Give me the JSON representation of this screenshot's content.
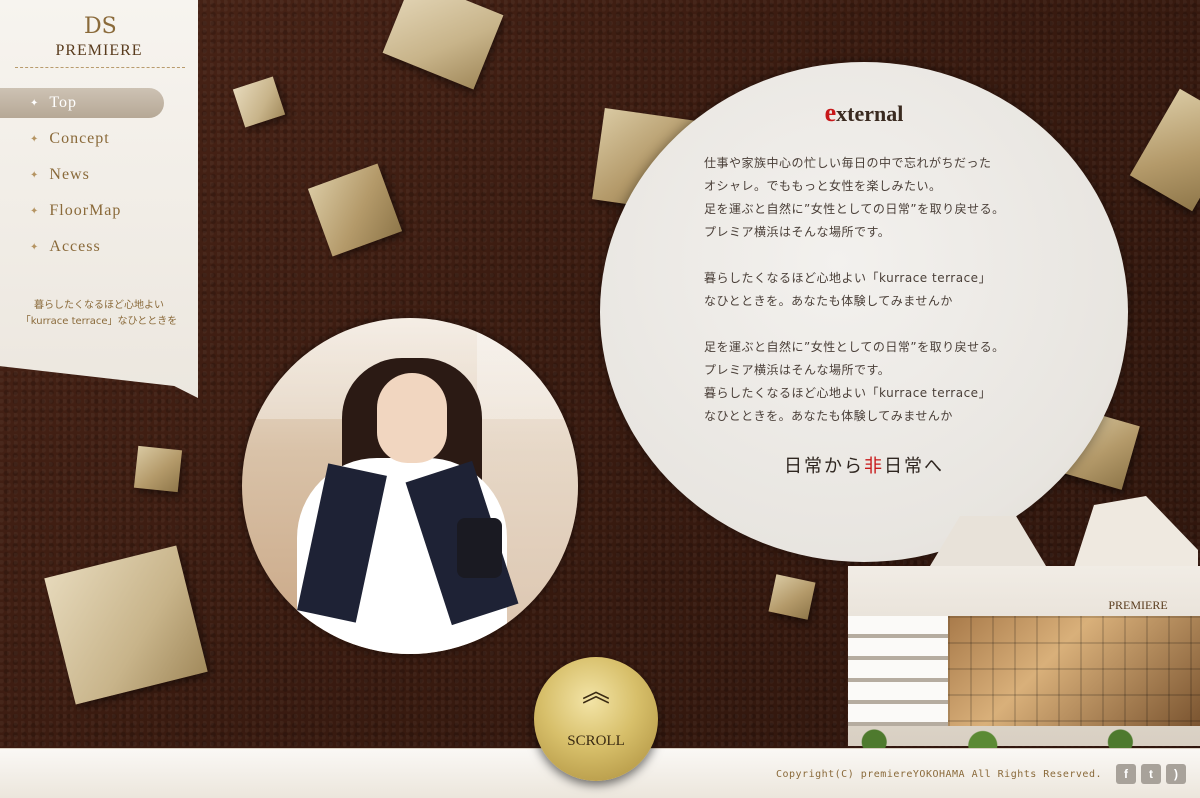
{
  "brand": {
    "mark": "DS",
    "name": "PREMIERE"
  },
  "nav": {
    "items": [
      {
        "label": "Top",
        "active": true
      },
      {
        "label": "Concept"
      },
      {
        "label": "News"
      },
      {
        "label": "FloorMap"
      },
      {
        "label": "Access"
      }
    ],
    "bullet_icon": "star-icon"
  },
  "sidebar": {
    "copy_line1": "暮らしたくなるほど心地よい",
    "copy_line2": "「kurrace terrace」なひとときを"
  },
  "info": {
    "title_initial": "e",
    "title_rest": "xternal",
    "paragraphs": [
      [
        "仕事や家族中心の忙しい毎日の中で忘れがちだった",
        "オシャレ。でももっと女性を楽しみたい。",
        "足を運ぶと自然に”女性としての日常”を取り戻せる。",
        "プレミア横浜はそんな場所です。"
      ],
      [
        "暮らしたくなるほど心地よい「kurrace terrace」",
        "なひとときを。あなたも体験してみませんか"
      ],
      [
        "足を運ぶと自然に”女性としての日常”を取り戻せる。",
        "プレミア横浜はそんな場所です。",
        "暮らしたくなるほど心地よい「kurrace terrace」",
        "なひとときを。あなたも体験してみませんか"
      ]
    ],
    "tagline_pre": "日常から",
    "tagline_hl": "非",
    "tagline_post": "日常へ",
    "accent_color": "#c8181a"
  },
  "building": {
    "sign": "PREMIERE"
  },
  "scroll": {
    "label": "SCROLL",
    "icon": "double-chevron-up-icon"
  },
  "footer": {
    "copyright": "Copyright(C) premiereYOKOHAMA All Rights Reserved.",
    "social": [
      {
        "name": "facebook-icon",
        "glyph": "f"
      },
      {
        "name": "twitter-icon",
        "glyph": "t"
      },
      {
        "name": "rss-icon",
        "glyph": ")"
      }
    ]
  }
}
